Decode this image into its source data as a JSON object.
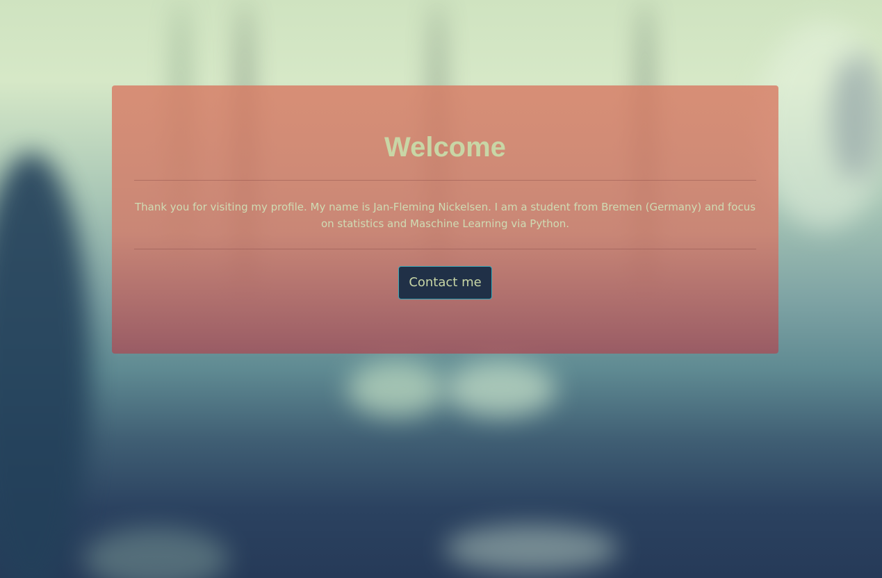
{
  "hero": {
    "title": "Welcome",
    "text": "Thank you for visiting my profile. My name is Jan-Fleming Nickelsen. I am a student from Bremen (Germany) and focus on statistics and Maschine Learning via Python.",
    "button_label": "Contact me"
  },
  "colors": {
    "card": "#d6786a",
    "title": "#c8d6a6",
    "text": "#cfdcb4",
    "button_bg": "#203047",
    "button_border": "#3aa9b8"
  }
}
